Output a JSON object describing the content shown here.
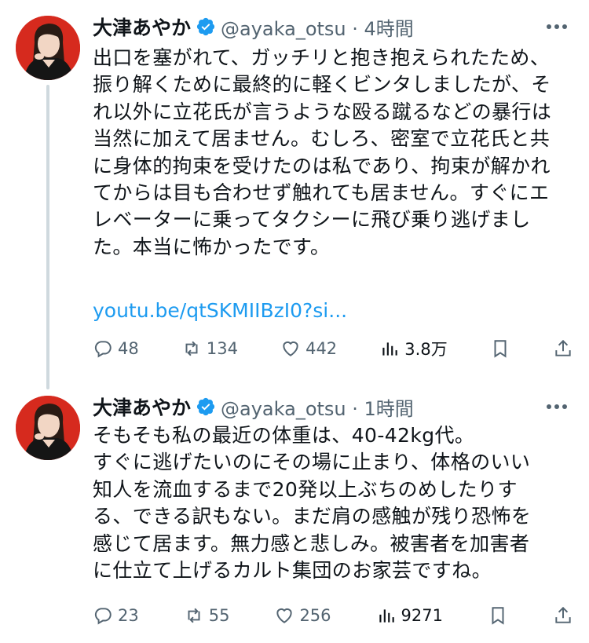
{
  "tweets": [
    {
      "name": "大津あやか",
      "handle": "@ayaka_otsu",
      "time": "4時間",
      "lines": [
        "出口を塞がれて、ガッチリと抱き抱えられたため、",
        "振り解くために最終的に軽くビンタしましたが、そ",
        "れ以外に立花氏が言うような殴る蹴るなどの暴行は",
        "当然に加えて居ません。むしろ、密室で立花氏と共",
        "に身体的拘束を受けたのは私であり、拘束が解かれ",
        "てからは目も合わせず触れても居ません。すぐにエ",
        "レベーターに乗ってタクシーに飛び乗り逃げまし",
        "た。本当に怖かったです。"
      ],
      "link": "youtu.be/qtSKMIIBzI0?si...",
      "replies": "48",
      "retweets": "134",
      "likes": "442",
      "views": "3.8万"
    },
    {
      "name": "大津あやか",
      "handle": "@ayaka_otsu",
      "time": "1時間",
      "lines": [
        "そもそも私の最近の体重は、40-42kg代。",
        "すぐに逃げたいのにその場に止まり、体格のいい",
        "知人を流血するまで20発以上ぶちのめしたりす",
        "る、できる訳もない。まだ肩の感触が残り恐怖を",
        "感じて居ます。無力感と悲しみ。被害者を加害者",
        "に仕立て上げるカルト集団のお家芸ですね。"
      ],
      "replies": "23",
      "retweets": "55",
      "likes": "256",
      "views": "9271"
    }
  ],
  "colors": {
    "accent": "#1d9bf0",
    "muted": "#536471",
    "text": "#0f1419",
    "avatar_bg": "#d62a1e"
  }
}
